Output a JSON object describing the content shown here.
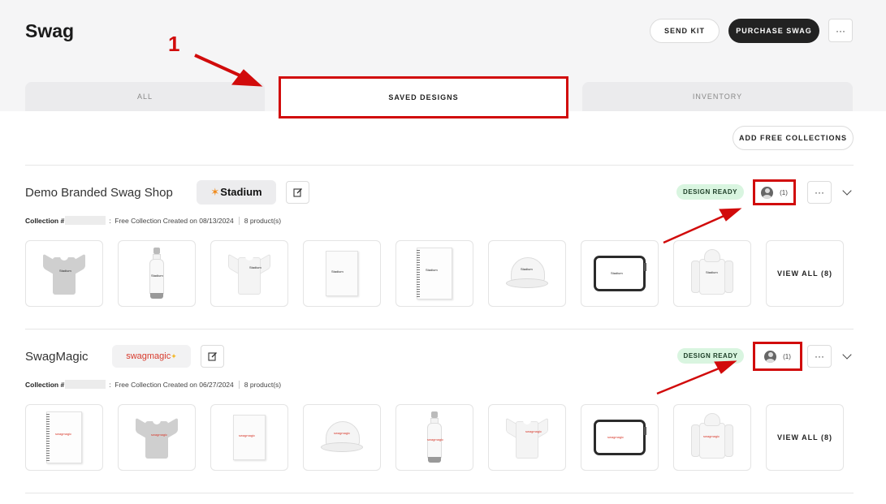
{
  "page": {
    "title": "Swag"
  },
  "header": {
    "send_kit_label": "SEND KIT",
    "purchase_label": "PURCHASE SWAG",
    "more_label": "···"
  },
  "tabs": [
    {
      "label": "ALL"
    },
    {
      "label": "SAVED DESIGNS",
      "active": true
    },
    {
      "label": "INVENTORY"
    }
  ],
  "annotation": {
    "step_number": "1",
    "color": "#d10b0b"
  },
  "add_collections_label": "ADD FREE COLLECTIONS",
  "collections": [
    {
      "name": "Demo Branded Swag Shop",
      "logo_text": "Stadium",
      "status": "DESIGN READY",
      "user_count": "(1)",
      "collection_label": "Collection #",
      "description": "Free Collection Created on 08/13/2024",
      "product_count": "8 product(s)",
      "view_all_label": "VIEW ALL (8)",
      "mark_text": "Stadium",
      "mark_color": "#222222"
    },
    {
      "name": "SwagMagic",
      "logo_text": "swagmagic",
      "status": "DESIGN READY",
      "user_count": "(1)",
      "collection_label": "Collection #",
      "description": "Free Collection Created on 06/27/2024",
      "product_count": "8 product(s)",
      "view_all_label": "VIEW ALL (8)",
      "mark_text": "swagmagic",
      "mark_color": "#d83a2c"
    }
  ],
  "colors": {
    "accent_dark": "#222222",
    "badge_green": "#d9f5e0",
    "annotation_red": "#d10b0b"
  }
}
